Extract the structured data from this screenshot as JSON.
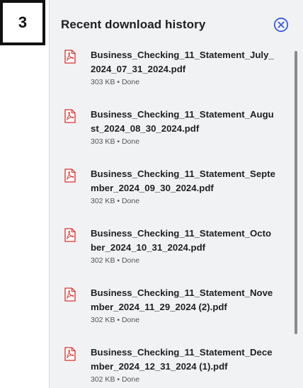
{
  "step_badge": {
    "label": "3"
  },
  "panel": {
    "title": "Recent download history",
    "close_icon": "close-circle-icon"
  },
  "downloads": [
    {
      "name": "Business_Checking_11_Statement_July_2024_07_31_2024.pdf",
      "size": "303 KB",
      "status": "Done",
      "meta": "303 KB • Done",
      "icon": "pdf-icon"
    },
    {
      "name": "Business_Checking_11_Statement_August_2024_08_30_2024.pdf",
      "size": "303 KB",
      "status": "Done",
      "meta": "303 KB • Done",
      "icon": "pdf-icon"
    },
    {
      "name": "Business_Checking_11_Statement_September_2024_09_30_2024.pdf",
      "size": "302 KB",
      "status": "Done",
      "meta": "302 KB • Done",
      "icon": "pdf-icon"
    },
    {
      "name": "Business_Checking_11_Statement_October_2024_10_31_2024.pdf",
      "size": "302 KB",
      "status": "Done",
      "meta": "302 KB • Done",
      "icon": "pdf-icon"
    },
    {
      "name": "Business_Checking_11_Statement_November_2024_11_29_2024 (2).pdf",
      "size": "302 KB",
      "status": "Done",
      "meta": "302 KB • Done",
      "icon": "pdf-icon"
    },
    {
      "name": "Business_Checking_11_Statement_December_2024_12_31_2024 (1).pdf",
      "size": "302 KB",
      "status": "Done",
      "meta": "302 KB • Done",
      "icon": "pdf-icon"
    }
  ],
  "colors": {
    "panel_bg": "#f1f2f4",
    "pdf_red": "#d9302c",
    "close_blue": "#3b5bdb",
    "text": "#1f1f1f"
  }
}
